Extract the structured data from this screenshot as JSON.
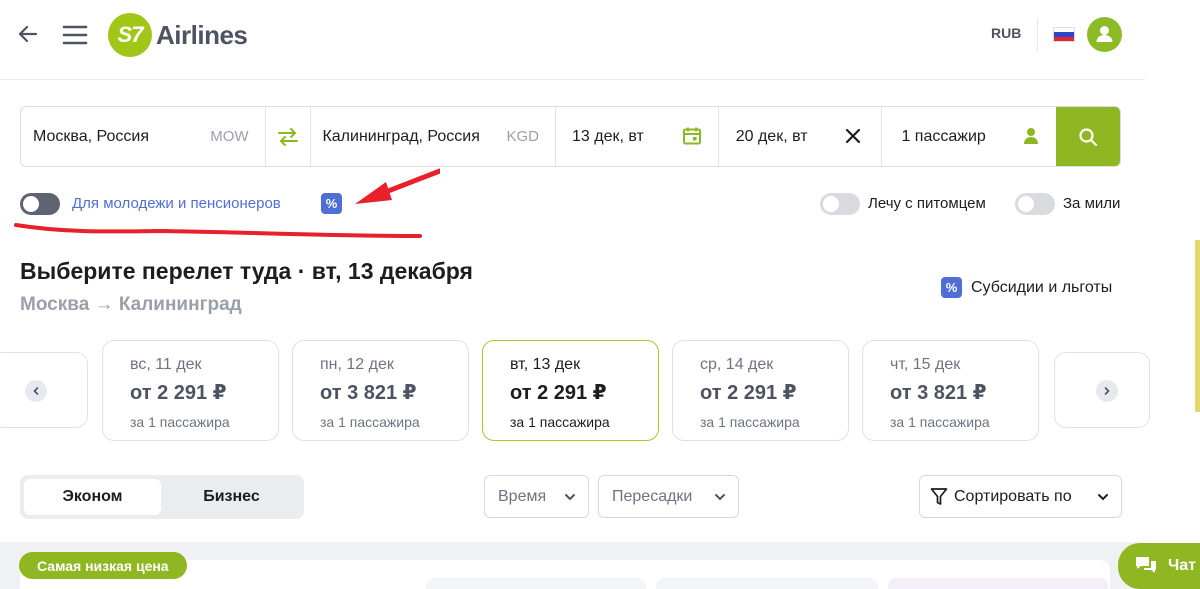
{
  "header": {
    "logo_mark": "S7",
    "logo_text": "Airlines",
    "currency": "RUB"
  },
  "search": {
    "from_city": "Москва, Россия",
    "from_code": "MOW",
    "to_city": "Калининград, Россия",
    "to_code": "KGD",
    "date_out": "13 дек, вт",
    "date_back": "20 дек, вт",
    "passengers": "1 пассажир"
  },
  "options": {
    "youth_label": "Для молодежи и пенсионеров",
    "pet_label": "Лечу с питомцем",
    "miles_label": "За мили",
    "pct_symbol": "%"
  },
  "page": {
    "title": "Выберите перелет туда · вт, 13 декабря",
    "route": "Москва → Калининград",
    "subsidy_label": "Субсидии и льготы"
  },
  "dates": [
    {
      "day": "вс, 11 дек",
      "price": "от 2 291 ₽",
      "pax": "за 1 пассажира"
    },
    {
      "day": "пн, 12 дек",
      "price": "от 3 821 ₽",
      "pax": "за 1 пассажира"
    },
    {
      "day": "вт, 13 дек",
      "price": "от 2 291 ₽",
      "pax": "за 1 пассажира"
    },
    {
      "day": "ср, 14 дек",
      "price": "от 2 291 ₽",
      "pax": "за 1 пассажира"
    },
    {
      "day": "чт, 15 дек",
      "price": "от 3 821 ₽",
      "pax": "за 1 пассажира"
    }
  ],
  "filters": {
    "economy": "Эконом",
    "business": "Бизнес",
    "time": "Время",
    "transfers": "Пересадки",
    "sort": "Сортировать по"
  },
  "results": {
    "badge": "Самая низкая цена"
  },
  "chat": {
    "label": "Чат"
  },
  "colors": {
    "accent_green": "#8fb722",
    "brand_blue": "#4f6fd6",
    "annotation_red": "#e8202a"
  }
}
